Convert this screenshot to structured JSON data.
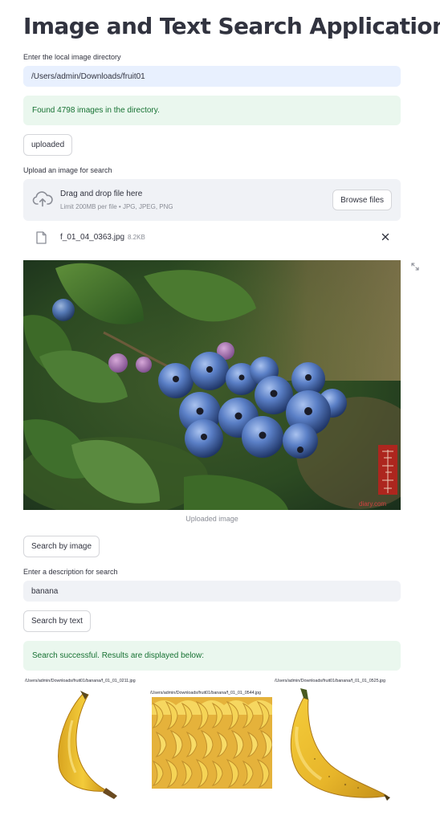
{
  "app": {
    "title": "Image and Text Search Application"
  },
  "directory": {
    "label": "Enter the local image directory",
    "value": "/Users/admin/Downloads/fruit01"
  },
  "found_message": "Found 4798 images in the directory.",
  "uploaded_button": "uploaded",
  "upload": {
    "label": "Upload an image for search",
    "drag_text": "Drag and drop file here",
    "limit_text": "Limit 200MB per file • JPG, JPEG, PNG",
    "browse_label": "Browse files",
    "file_name": "f_01_04_0363.jpg",
    "file_size": "8.2KB"
  },
  "uploaded_image": {
    "caption": "Uploaded image",
    "watermark": "diary.com"
  },
  "search_image_button": "Search by image",
  "text_search": {
    "label": "Enter a description for search",
    "value": "banana",
    "button": "Search by text"
  },
  "success_message": "Search successful. Results are displayed below:",
  "results": [
    {
      "path": "/Users/admin/Downloads/fruit01/banana/f_01_01_0211.jpg"
    },
    {
      "path": "/Users/admin/Downloads/fruit01/banana/f_01_01_0544.jpg"
    },
    {
      "path": "/Users/admin/Downloads/fruit01/banana/f_01_01_0525.jpg"
    }
  ],
  "colors": {
    "accent_success_bg": "#eaf7ee",
    "accent_success_text": "#177233",
    "input_bg": "#f0f2f6",
    "focused_input_bg": "#e8f0fe",
    "blueberry": "#4f72b8"
  },
  "icons": [
    "cloud-upload-icon",
    "file-icon",
    "close-icon",
    "fullscreen-icon"
  ]
}
